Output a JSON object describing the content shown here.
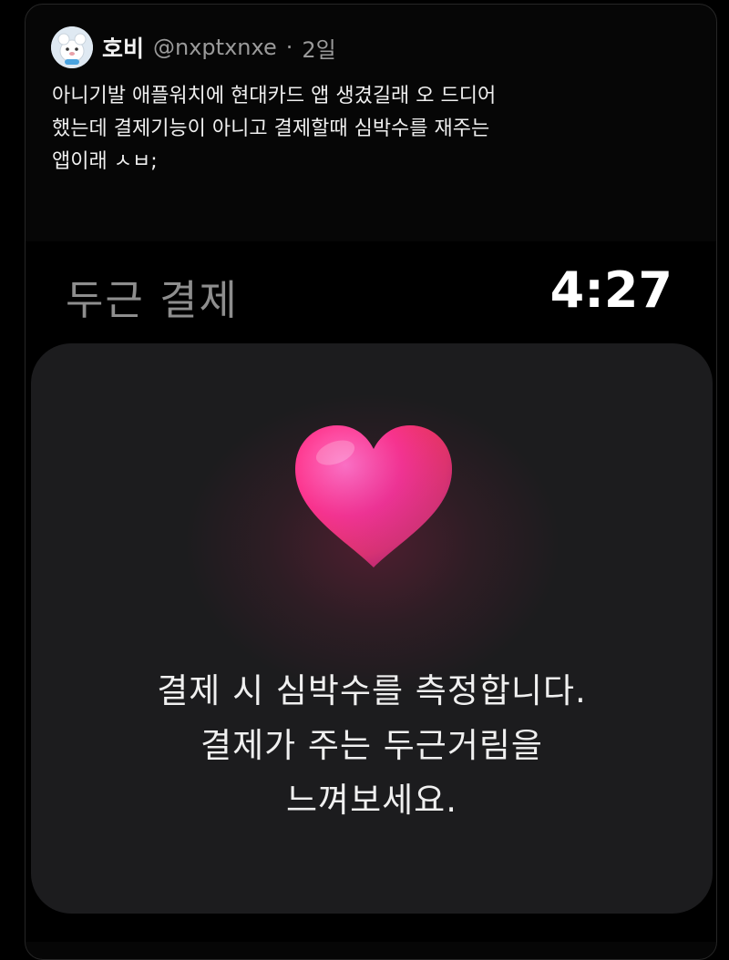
{
  "tweet": {
    "display_name": "호비",
    "handle": "@nxptxnxe",
    "separator": "·",
    "time": "2일",
    "text_lines": [
      "아니기발 애플워치에 현대카드 앱 생겼길래 오 드디어",
      "했는데 결제기능이 아니고 결제할때 심박수를 재주는",
      "앱이래 ㅅㅂ;"
    ]
  },
  "watch": {
    "app_title": "두근 결제",
    "clock": "4:27",
    "heart_icon": "heart-icon",
    "message_lines": [
      "결제 시 심박수를 측정합니다.",
      "결제가 주는 두근거림을",
      "느껴보세요."
    ]
  },
  "colors": {
    "background": "#000000",
    "panel": "#1c1c1e",
    "heart": "#ff2d6f"
  }
}
